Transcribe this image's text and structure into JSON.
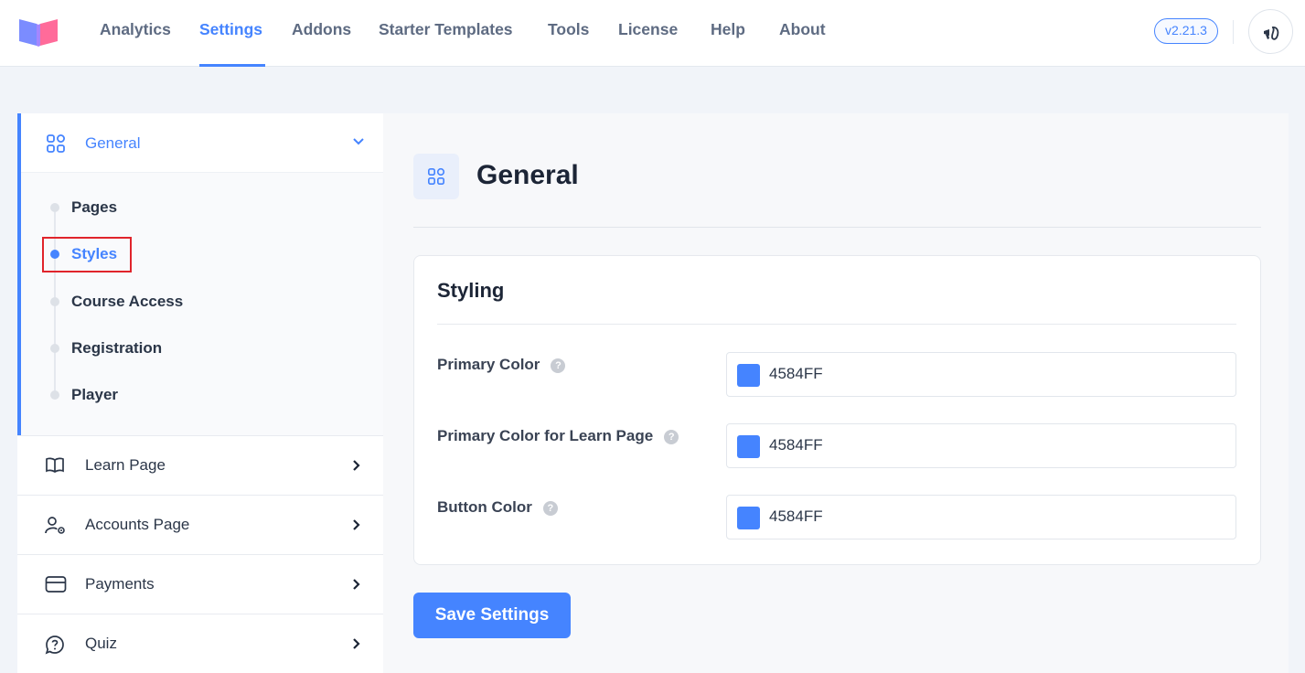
{
  "colors": {
    "accent": "#4584FF",
    "swatch": "#4584FF"
  },
  "topbar": {
    "nav": [
      {
        "label": "Analytics"
      },
      {
        "label": "Settings",
        "active": true
      },
      {
        "label": "Addons"
      },
      {
        "label": "Starter Templates"
      },
      {
        "label": "Tools"
      },
      {
        "label": "License"
      },
      {
        "label": "Help"
      },
      {
        "label": "About"
      }
    ],
    "version": "v2.21.3",
    "announcement_icon": "megaphone-icon"
  },
  "sidebar": {
    "general": {
      "label": "General",
      "icon": "grid-icon",
      "expanded": true
    },
    "sub_items": [
      {
        "label": "Pages"
      },
      {
        "label": "Styles",
        "active": true
      },
      {
        "label": "Course Access"
      },
      {
        "label": "Registration"
      },
      {
        "label": "Player"
      }
    ],
    "items": [
      {
        "label": "Learn Page",
        "icon": "book-open-icon"
      },
      {
        "label": "Accounts Page",
        "icon": "user-gear-icon"
      },
      {
        "label": "Payments",
        "icon": "credit-card-icon"
      },
      {
        "label": "Quiz",
        "icon": "quiz-icon"
      }
    ]
  },
  "main": {
    "title": "General",
    "section": {
      "title": "Styling",
      "fields": [
        {
          "label": "Primary Color",
          "value": "4584FF"
        },
        {
          "label": "Primary Color for Learn Page",
          "value": "4584FF"
        },
        {
          "label": "Button Color",
          "value": "4584FF"
        }
      ]
    },
    "save_label": "Save Settings"
  }
}
